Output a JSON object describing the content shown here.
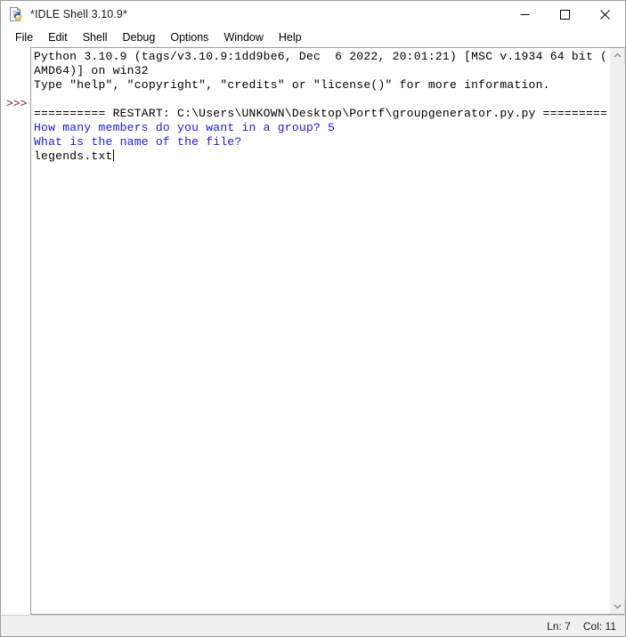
{
  "window": {
    "title": "*IDLE Shell 3.10.9*",
    "icon": "python-file-icon",
    "controls": {
      "minimize": "minimize-icon",
      "maximize": "maximize-icon",
      "close": "close-icon"
    }
  },
  "menubar": {
    "items": [
      {
        "label": "File"
      },
      {
        "label": "Edit"
      },
      {
        "label": "Shell"
      },
      {
        "label": "Debug"
      },
      {
        "label": "Options"
      },
      {
        "label": "Window"
      },
      {
        "label": "Help"
      }
    ]
  },
  "gutter": {
    "prompt": ">>>"
  },
  "shell": {
    "lines": [
      {
        "text": "Python 3.10.9 (tags/v3.10.9:1dd9be6, Dec  6 2022, 20:01:21) [MSC v.1934 64 bit (",
        "color": "black"
      },
      {
        "text": "AMD64)] on win32",
        "color": "black"
      },
      {
        "text": "Type \"help\", \"copyright\", \"credits\" or \"license()\" for more information.",
        "color": "black"
      },
      {
        "text": "",
        "color": "black"
      },
      {
        "text": "========== RESTART: C:\\Users\\UNKOWN\\Desktop\\Portf\\groupgenerator.py.py =========",
        "color": "black"
      },
      {
        "text": "How many members do you want in a group? 5",
        "color": "blue"
      },
      {
        "text": "What is the name of the file?",
        "color": "blue"
      },
      {
        "text": "legends.txt",
        "color": "black",
        "cursor": true
      }
    ]
  },
  "scrollbar": {
    "up_arrow": "chevron-up-icon",
    "down_arrow": "chevron-down-icon"
  },
  "statusbar": {
    "line_label": "Ln: 7",
    "col_label": "Col: 11"
  },
  "colors": {
    "prompt": "#8b1a1a",
    "stdout_blue": "#1919e6",
    "text_black": "#000000",
    "window_bg": "#ffffff",
    "chrome_bg": "#f0f0f0",
    "border": "#9b9b9b"
  }
}
